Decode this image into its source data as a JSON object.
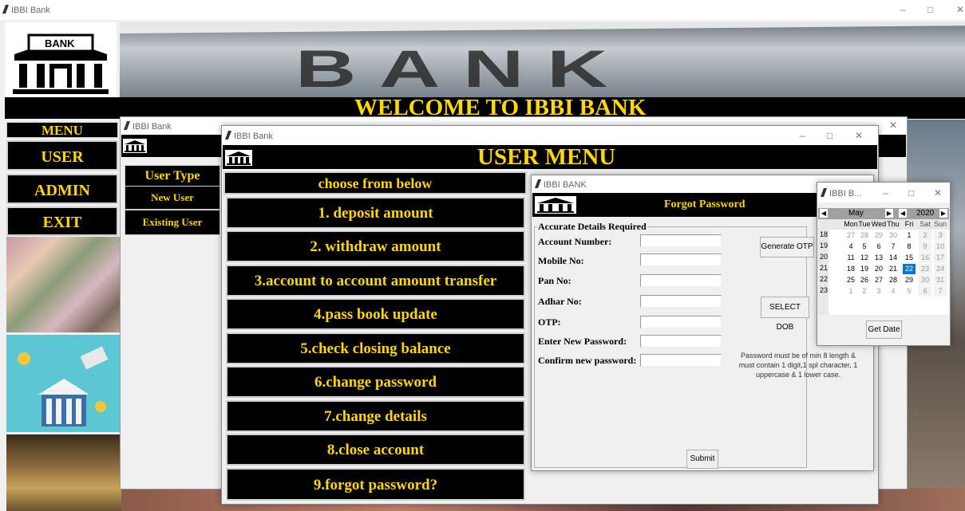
{
  "main_window": {
    "title": "IBBI Bank",
    "logo_text": "BANK",
    "banner_text": "BANK",
    "welcome": "WELCOME TO IBBI BANK"
  },
  "side_menu": {
    "header": "MENU",
    "items": [
      {
        "label": "USER"
      },
      {
        "label": "ADMIN"
      },
      {
        "label": "EXIT"
      }
    ]
  },
  "user_type_window": {
    "title": "IBBI Bank",
    "logo_text": "BANK",
    "heading": "User Type",
    "new_user": "New User",
    "existing_user": "Existing User"
  },
  "user_menu_window": {
    "title": "IBBI Bank",
    "logo_text": "BANK",
    "heading": "USER MENU",
    "choose": "choose from below",
    "options": [
      "1. deposit amount",
      "2. withdraw amount",
      "3.account to account amount transfer",
      "4.pass book update",
      "5.check closing balance",
      "6.change password",
      "7.change details",
      "8.close account",
      "9.forgot password?"
    ]
  },
  "forgot_window": {
    "title": "IBBI BANK",
    "logo_text": "BANK",
    "heading": "Forgot Password",
    "frame_label": "Accurate Details Required",
    "fields": {
      "account_number": {
        "label": "Account Number:",
        "value": ""
      },
      "mobile": {
        "label": "Mobile No:",
        "value": ""
      },
      "pan": {
        "label": "Pan No:",
        "value": ""
      },
      "adhar": {
        "label": "Adhar No:",
        "value": ""
      },
      "otp": {
        "label": "OTP:",
        "value": ""
      },
      "new_password": {
        "label": "Enter New Password:",
        "value": ""
      },
      "confirm_password": {
        "label": "Confirm new password:",
        "value": ""
      }
    },
    "generate_otp": "Generate OTP",
    "select_dob": "SELECT DOB",
    "password_hint": "Password must be of min 8 length & must contain 1 digit,1 spl character, 1 uppercase & 1 lower case.",
    "submit": "Submit"
  },
  "calendar_window": {
    "title": "IBBI B...",
    "month": "May",
    "year": "2020",
    "weekdays": [
      "Mon",
      "Tue",
      "Wed",
      "Thu",
      "Fri",
      "Sat",
      "Sun"
    ],
    "weeks": [
      {
        "num": "18",
        "days": [
          "27",
          "28",
          "29",
          "30",
          "1",
          "2",
          "3"
        ]
      },
      {
        "num": "19",
        "days": [
          "4",
          "5",
          "6",
          "7",
          "8",
          "9",
          "10"
        ]
      },
      {
        "num": "20",
        "days": [
          "11",
          "12",
          "13",
          "14",
          "15",
          "16",
          "17"
        ]
      },
      {
        "num": "21",
        "days": [
          "18",
          "19",
          "20",
          "21",
          "22",
          "23",
          "24"
        ]
      },
      {
        "num": "22",
        "days": [
          "25",
          "26",
          "27",
          "28",
          "29",
          "30",
          "31"
        ]
      },
      {
        "num": "23",
        "days": [
          "1",
          "2",
          "3",
          "4",
          "5",
          "6",
          "7"
        ]
      }
    ],
    "selected_day": "22",
    "get_date": "Get Date"
  },
  "colors": {
    "accent_yellow": "#ffd800",
    "selected_blue": "#0078d7"
  }
}
